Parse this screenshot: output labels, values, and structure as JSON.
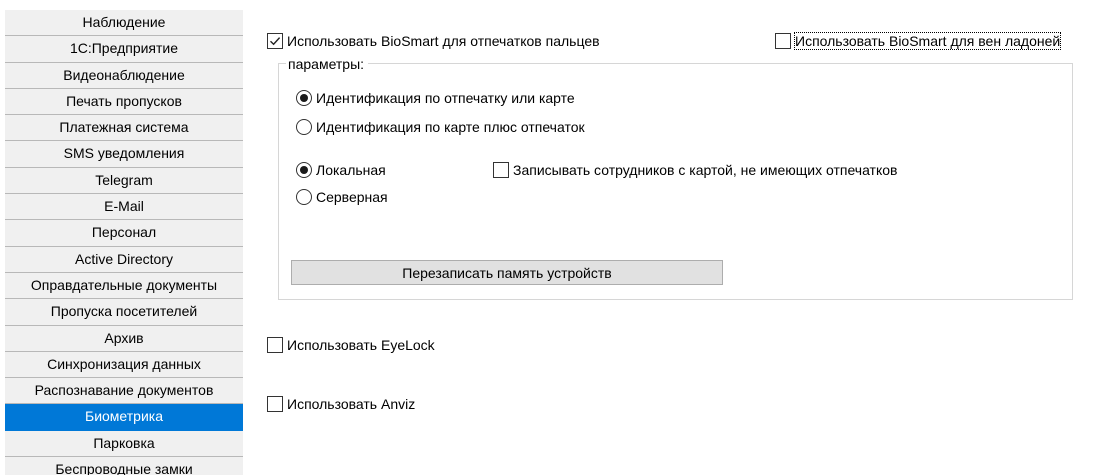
{
  "sidebar": {
    "items": [
      {
        "label": "Наблюдение",
        "active": false
      },
      {
        "label": "1С:Предприятие",
        "active": false
      },
      {
        "label": "Видеонаблюдение",
        "active": false
      },
      {
        "label": "Печать пропусков",
        "active": false
      },
      {
        "label": "Платежная система",
        "active": false
      },
      {
        "label": "SMS уведомления",
        "active": false
      },
      {
        "label": "Telegram",
        "active": false
      },
      {
        "label": "E-Mail",
        "active": false
      },
      {
        "label": "Персонал",
        "active": false
      },
      {
        "label": "Active Directory",
        "active": false
      },
      {
        "label": "Оправдательные документы",
        "active": false
      },
      {
        "label": "Пропуска посетителей",
        "active": false
      },
      {
        "label": "Архив",
        "active": false
      },
      {
        "label": "Синхронизация данных",
        "active": false
      },
      {
        "label": "Распознавание документов",
        "active": false
      },
      {
        "label": "Биометрика",
        "active": true
      },
      {
        "label": "Парковка",
        "active": false
      },
      {
        "label": "Беспроводные замки",
        "active": false
      }
    ]
  },
  "biosmart": {
    "fingerprint_label": "Использовать BioSmart для отпечатков пальцев",
    "fingerprint_checked": true,
    "palm_label": "Использовать BioSmart для вен ладоней",
    "palm_checked": false
  },
  "params": {
    "legend": "параметры:",
    "ident_options": [
      {
        "label": "Идентификация по отпечатку или карте",
        "selected": true
      },
      {
        "label": "Идентификация по карте плюс отпечаток",
        "selected": false
      }
    ],
    "mode_options": [
      {
        "label": "Локальная",
        "selected": true
      },
      {
        "label": "Серверная",
        "selected": false
      }
    ],
    "record_label": "Записывать сотрудников с картой, не имеющих отпечатков",
    "record_checked": false,
    "rewrite_button": "Перезаписать память устройств"
  },
  "eyelock": {
    "label": "Использовать EyeLock",
    "checked": false
  },
  "anviz": {
    "label": "Использовать Anviz",
    "checked": false
  },
  "colors": {
    "accent": "#0078d7"
  }
}
